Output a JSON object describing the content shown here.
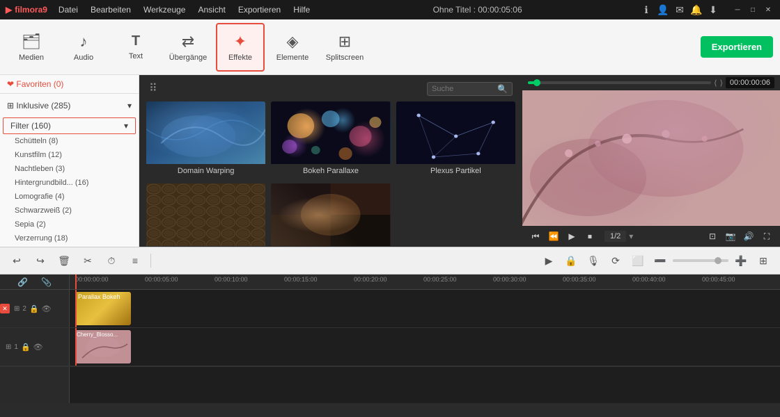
{
  "app": {
    "name": "filmora9",
    "logo": "▶",
    "title": "Ohne Titel : 00:00:05:06"
  },
  "menus": {
    "items": [
      "Datei",
      "Bearbeiten",
      "Werkzeuge",
      "Ansicht",
      "Exportieren",
      "Hilfe"
    ]
  },
  "toolbar": {
    "items": [
      {
        "id": "medien",
        "icon": "🗂",
        "label": "Medien"
      },
      {
        "id": "audio",
        "icon": "♪",
        "label": "Audio"
      },
      {
        "id": "text",
        "icon": "T",
        "label": "Text"
      },
      {
        "id": "uebergaenge",
        "icon": "⇄",
        "label": "Übergänge"
      },
      {
        "id": "effekte",
        "icon": "✦",
        "label": "Effekte",
        "active": true
      },
      {
        "id": "elemente",
        "icon": "◈",
        "label": "Elemente"
      },
      {
        "id": "splitscreen",
        "icon": "⊞",
        "label": "Splitscreen"
      }
    ],
    "export_label": "Exportieren"
  },
  "left_panel": {
    "favorites": "❤ Favoriten (0)",
    "sections": [
      {
        "label": "⊞ Inklusive (285)",
        "expanded": true,
        "items": []
      },
      {
        "label": "Filter (160)",
        "expanded": true,
        "selected": true,
        "items": [
          "Schütteln (8)",
          "Kunstfilm (12)",
          "Nachtleben (3)",
          "Hintergrundbild... (16)",
          "Lomografie (4)",
          "Schwarzweiß (2)",
          "Sepia (2)",
          "Verzerrung (18)"
        ]
      }
    ]
  },
  "effects_panel": {
    "search_placeholder": "Suche",
    "effects": [
      {
        "id": "domain-warping",
        "label": "Domain Warping",
        "thumb": "domain"
      },
      {
        "id": "bokeh-parallaxe",
        "label": "Bokeh Parallaxe",
        "thumb": "bokeh"
      },
      {
        "id": "plexus-partikel",
        "label": "Plexus Partikel",
        "thumb": "plexus"
      },
      {
        "id": "scales",
        "label": "",
        "thumb": "scales"
      },
      {
        "id": "abstract",
        "label": "",
        "thumb": "abstract"
      }
    ]
  },
  "preview": {
    "timecode": "00:00:00:06",
    "speed": "1/2",
    "playback_buttons": [
      "⏮",
      "⏪",
      "▶",
      "⏹"
    ]
  },
  "timeline": {
    "ruler_marks": [
      "00:00:00:00",
      "00:00:05:00",
      "00:00:10:00",
      "00:00:15:00",
      "00:00:20:00",
      "00:00:25:00",
      "00:00:30:00",
      "00:00:35:00",
      "00:00:40:00",
      "00:00:45:00"
    ],
    "tracks": [
      {
        "id": "track2",
        "num": "2",
        "clips": [
          {
            "label": "Parallax Bokeh",
            "type": "golden"
          }
        ]
      },
      {
        "id": "track1",
        "num": "1",
        "clips": [
          {
            "label": "Cherry_Blosso...",
            "type": "blue"
          }
        ]
      }
    ],
    "toolbar2": {
      "buttons_left": [
        "↩",
        "↪",
        "🗑",
        "✂",
        "⏱",
        "≡"
      ],
      "buttons_right": [
        "▶",
        "🔒",
        "🎙",
        "⟳",
        "⬜",
        "➖",
        "➕",
        "⊞"
      ]
    }
  }
}
